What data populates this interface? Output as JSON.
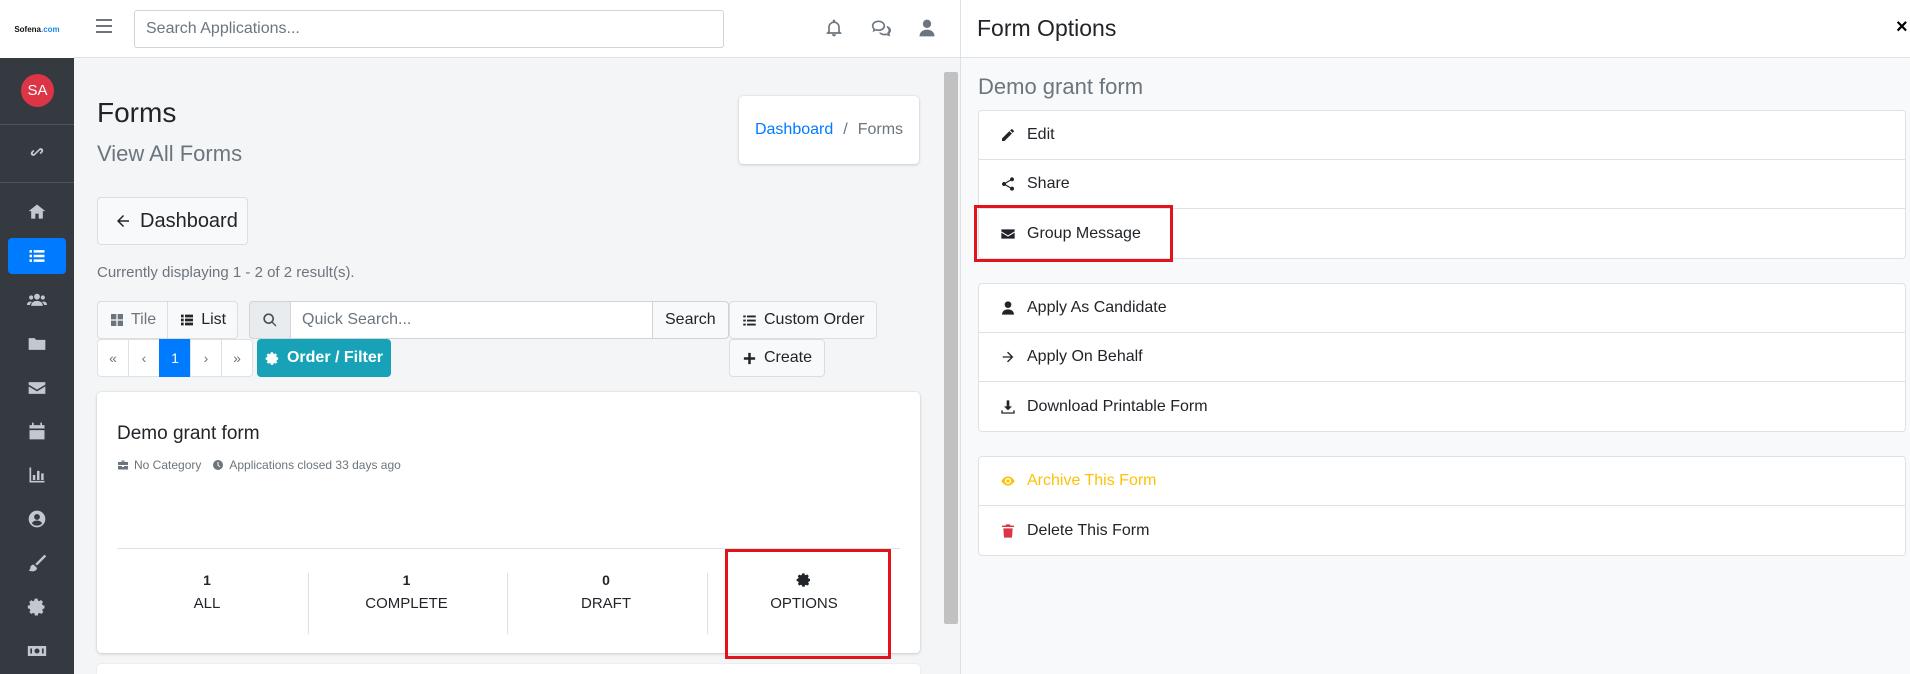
{
  "sidebar": {
    "logo_text": "Sofena",
    "logo_domain": ".com",
    "avatar_initials": "SA",
    "items": [
      {
        "name": "link-icon"
      },
      {
        "name": "home-icon"
      },
      {
        "name": "list-icon",
        "active": true
      },
      {
        "name": "users-icon"
      },
      {
        "name": "folder-icon"
      },
      {
        "name": "envelope-icon"
      },
      {
        "name": "calendar-icon"
      },
      {
        "name": "chart-bar-icon"
      },
      {
        "name": "user-circle-icon"
      },
      {
        "name": "paint-brush-icon"
      },
      {
        "name": "gear-icon"
      },
      {
        "name": "money-bill-icon"
      }
    ]
  },
  "topbar": {
    "search_placeholder": "Search Applications...",
    "icons": [
      "bell-icon",
      "comments-icon",
      "user-icon"
    ]
  },
  "page": {
    "title": "Forms",
    "subtitle": "View All Forms",
    "breadcrumb": {
      "home": "Dashboard",
      "separator": "/",
      "current": "Forms"
    },
    "back_button": "Dashboard",
    "results_text": "Currently displaying 1 - 2 of 2 result(s).",
    "view_toggle": {
      "tile": "Tile",
      "list": "List",
      "selected": "List"
    },
    "quick_search_placeholder": "Quick Search...",
    "search_button": "Search",
    "custom_order_button": "Custom Order",
    "create_button": "Create",
    "order_filter_button": "Order / Filter",
    "pagination": {
      "first": "«",
      "prev": "‹",
      "current": "1",
      "next": "›",
      "last": "»"
    }
  },
  "form_card": {
    "title": "Demo grant form",
    "category": "No Category",
    "status": "Applications closed 33 days ago",
    "stats": [
      {
        "value": "1",
        "label": "ALL"
      },
      {
        "value": "1",
        "label": "COMPLETE"
      },
      {
        "value": "0",
        "label": "DRAFT"
      }
    ],
    "options_label": "OPTIONS"
  },
  "panel": {
    "title": "Form Options",
    "close": "×",
    "form_name": "Demo grant form",
    "group1": [
      {
        "label": "Edit",
        "icon": "pencil-icon"
      },
      {
        "label": "Share",
        "icon": "share-icon"
      },
      {
        "label": "Group Message",
        "icon": "envelope-icon"
      }
    ],
    "group2": [
      {
        "label": "Apply As Candidate",
        "icon": "user-icon"
      },
      {
        "label": "Apply On Behalf",
        "icon": "arrow-right-icon"
      },
      {
        "label": "Download Printable Form",
        "icon": "download-icon"
      }
    ],
    "group3": [
      {
        "label": "Archive This Form",
        "icon": "eye-icon"
      },
      {
        "label": "Delete This Form",
        "icon": "trash-icon"
      }
    ]
  },
  "colors": {
    "sidebar_bg": "#343a40",
    "primary": "#007bff",
    "info": "#17a2b8",
    "warning": "#ffc107",
    "danger": "#dc3545",
    "highlight": "#e3131b"
  }
}
